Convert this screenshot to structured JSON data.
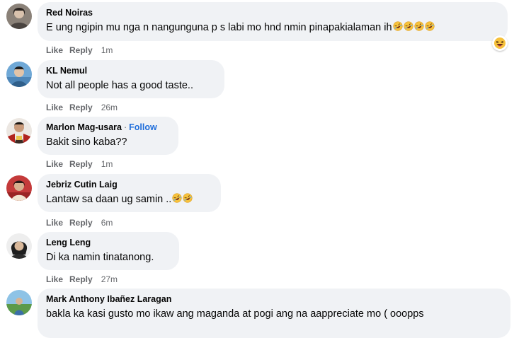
{
  "actions": {
    "like_label": "Like",
    "reply_label": "Reply"
  },
  "comments": [
    {
      "author": "Red Noiras",
      "text": "E ung ngipin mu nga n nangunguna p s labi mo hnd nmin pinapakialaman ih",
      "emojis": [
        "rofl",
        "rofl",
        "rofl",
        "rofl"
      ],
      "time": "1m",
      "reaction": "haha"
    },
    {
      "author": "KL Nemul",
      "text": "Not all people has a good taste..",
      "time": "26m"
    },
    {
      "author": "Marlon Mag-usara",
      "separator": "·",
      "follow_label": "Follow",
      "text": "Bakit sino kaba??",
      "time": "1m"
    },
    {
      "author": "Jebriz Cutin Laig",
      "text": "Lantaw sa daan ug samin ..",
      "emojis": [
        "rofl",
        "rofl"
      ],
      "time": "6m"
    },
    {
      "author": "Leng Leng",
      "text": "Di ka namin tinatanong.",
      "time": "27m"
    },
    {
      "author": "Mark Anthony Ibañez Laragan",
      "text": "bakla ka kasi gusto mo ikaw ang maganda at pogi ang na aappreciate mo ( ooopps"
    }
  ],
  "colors": {
    "bubble": "#f0f2f5",
    "follow": "#216fdb",
    "meta": "#65676b"
  }
}
